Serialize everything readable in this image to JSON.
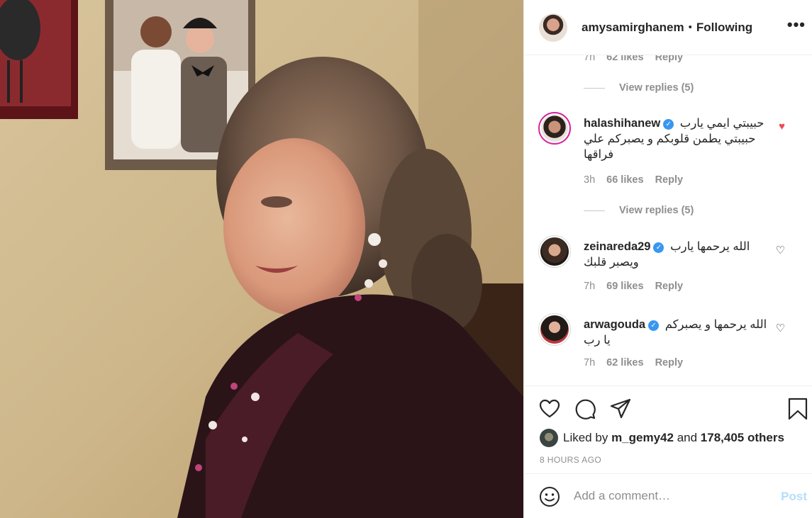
{
  "header": {
    "username": "amysamirghanem",
    "separator": "•",
    "follow_state": "Following",
    "more": "•••"
  },
  "comments": {
    "top_meta": {
      "time": "7h",
      "likes": "62 likes",
      "reply": "Reply"
    },
    "view_replies_1": "View replies (5)",
    "items": [
      {
        "username": "halashihanew",
        "text": "حبيبتي ايمي يارب حبيبتي يطمن قلوبكم و يصبركم علي فراقها",
        "time": "3h",
        "likes": "66 likes",
        "reply": "Reply",
        "liked": true
      },
      {
        "username": "zeinareda29",
        "text": "الله يرحمها يارب ويصبر قلبك",
        "time": "7h",
        "likes": "69 likes",
        "reply": "Reply",
        "liked": false
      },
      {
        "username": "arwagouda",
        "text": "الله يرحمها و يصبركم يا رب",
        "time": "7h",
        "likes": "62 likes",
        "reply": "Reply",
        "liked": false
      }
    ],
    "view_replies_2": "View replies (5)"
  },
  "likes": {
    "prefix": "Liked by",
    "user": "m_gemy42",
    "and": "and",
    "count": "178,405 others"
  },
  "timestamp": "8 HOURS AGO",
  "add_comment": {
    "placeholder": "Add a comment…",
    "post_label": "Post"
  },
  "colors": {
    "liked_heart": "#ed4956",
    "verified": "#3897f0",
    "post_disabled": "#b2dffc"
  },
  "icons": {
    "like": "heart-outline-icon",
    "comment": "speech-bubble-icon",
    "share": "paper-plane-icon",
    "save": "bookmark-icon",
    "emoji": "smiley-icon"
  }
}
